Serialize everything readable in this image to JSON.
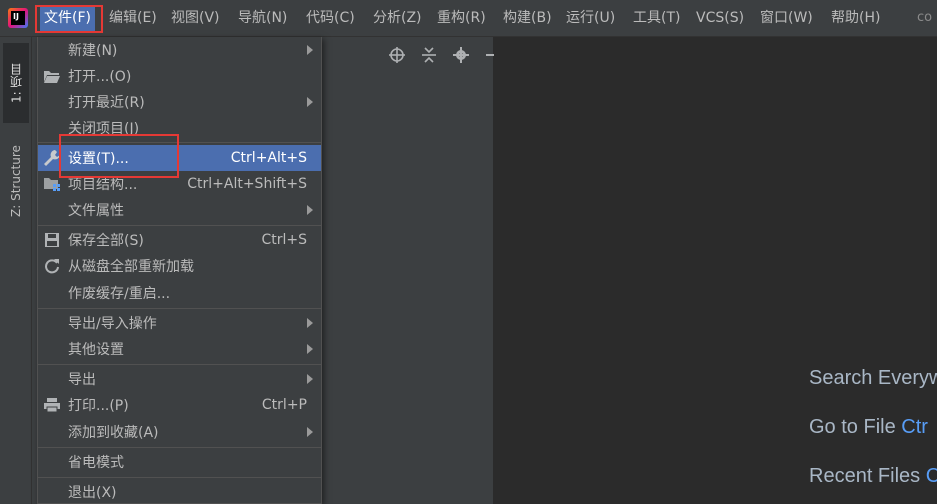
{
  "menubar": {
    "items": [
      {
        "label": "文件(F)",
        "active": true
      },
      {
        "label": "编辑(E)"
      },
      {
        "label": "视图(V)"
      },
      {
        "label": "导航(N)"
      },
      {
        "label": "代码(C)"
      },
      {
        "label": "分析(Z)"
      },
      {
        "label": "重构(R)"
      },
      {
        "label": "构建(B)"
      },
      {
        "label": "运行(U)"
      },
      {
        "label": "工具(T)"
      },
      {
        "label": "VCS(S)"
      },
      {
        "label": "窗口(W)"
      },
      {
        "label": "帮助(H)"
      }
    ],
    "title_fragment": "co",
    "app_icon_text": "IJ"
  },
  "tool_stripe": {
    "project_tab": "1: 项目",
    "structure_tab": "Z: Structure"
  },
  "project_toolbar": {
    "locate_icon": "target-icon",
    "collapse_icon": "collapse-icon",
    "settings_icon": "gear-icon",
    "hide_icon": "minus-icon"
  },
  "file_menu": {
    "new": {
      "label": "新建(N)"
    },
    "open": {
      "label": "打开...(O)",
      "icon": "folder-open-icon"
    },
    "open_recent": {
      "label": "打开最近(R)"
    },
    "close_project": {
      "label": "关闭项目(J)"
    },
    "settings": {
      "label": "设置(T)...",
      "shortcut": "Ctrl+Alt+S",
      "icon": "wrench-icon"
    },
    "project_structure": {
      "label": "项目结构...",
      "shortcut": "Ctrl+Alt+Shift+S",
      "icon": "project-structure-icon"
    },
    "file_properties": {
      "label": "文件属性"
    },
    "save_all": {
      "label": "保存全部(S)",
      "shortcut": "Ctrl+S",
      "icon": "save-icon"
    },
    "reload_from_disk": {
      "label": "从磁盘全部重新加载",
      "icon": "refresh-icon"
    },
    "invalidate_caches": {
      "label": "作废缓存/重启..."
    },
    "import_export": {
      "label": "导出/导入操作"
    },
    "other_settings": {
      "label": "其他设置"
    },
    "export": {
      "label": "导出"
    },
    "print": {
      "label": "打印...(P)",
      "shortcut": "Ctrl+P",
      "icon": "printer-icon"
    },
    "add_to_favorites": {
      "label": "添加到收藏(A)"
    },
    "power_save": {
      "label": "省电模式"
    },
    "exit": {
      "label": "退出(X)"
    }
  },
  "editor_hints": [
    {
      "label": "Search Everyw",
      "key": ""
    },
    {
      "label": "Go to File ",
      "key": "Ctr"
    },
    {
      "label": "Recent Files ",
      "key": "C"
    }
  ],
  "colors": {
    "accent": "#4b6eaf",
    "highlight_box": "#e53935",
    "background": "#2b2b2b",
    "panel": "#3c3f41"
  }
}
